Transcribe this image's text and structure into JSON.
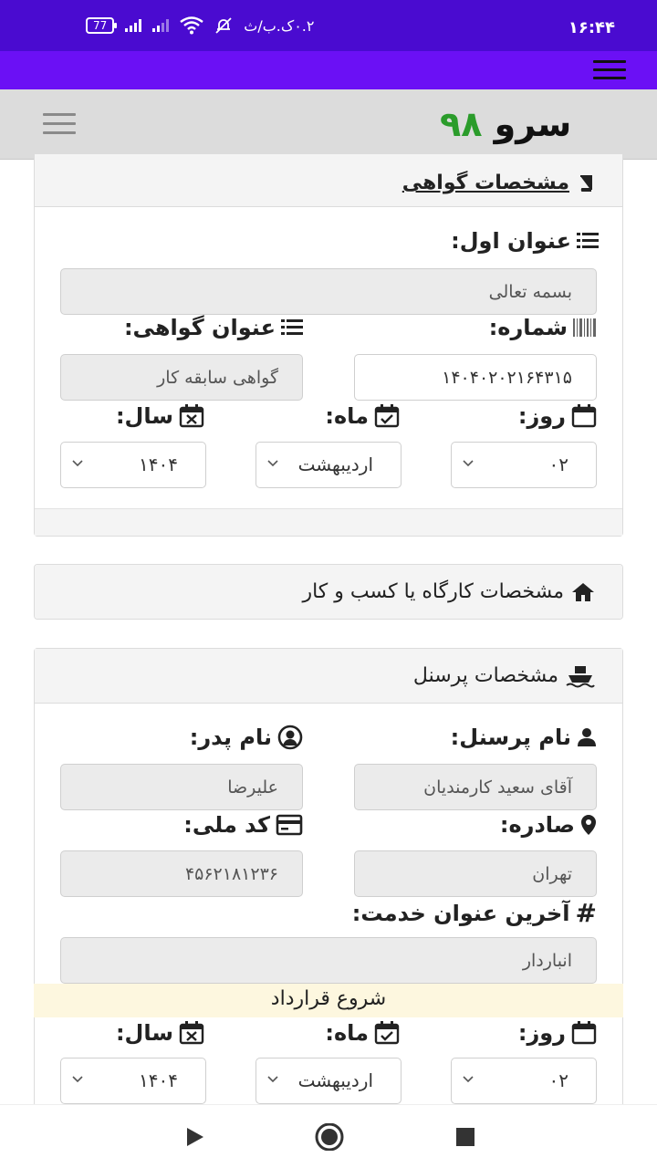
{
  "status_bar": {
    "time": "۱۶:۴۴",
    "battery": "77",
    "speed": "۰.۲ک.ب/ث"
  },
  "brand": {
    "part1": "سرو",
    "part2": "۹۸"
  },
  "certificate_section": {
    "header": "مشخصات گواهی",
    "first_title_label": "عنوان اول:",
    "first_title_value": "بسمه تعالی",
    "number_label": "شماره:",
    "number_value": "۱۴۰۴۰۲۰۲۱۶۴۳۱۵",
    "certificate_title_label": "عنوان گواهی:",
    "certificate_title_value": "گواهی سابقه کار",
    "day_label": "روز:",
    "month_label": "ماه:",
    "year_label": "سال:",
    "day_value": "۰۲",
    "month_value": "اردیبهشت",
    "year_value": "۱۴۰۴"
  },
  "workplace_section": {
    "header": "مشخصات کارگاه یا کسب و کار"
  },
  "personnel_section": {
    "header": "مشخصات پرسنل",
    "name_label": "نام پرسنل:",
    "name_value": "آقای سعید کارمندیان",
    "father_label": "نام پدر:",
    "father_value": "علیرضا",
    "issued_label": "صادره:",
    "issued_value": "تهران",
    "national_code_label": "کد ملی:",
    "national_code_value": "۴۵۶۲۱۸۱۲۳۶",
    "last_title_label": "آخرین عنوان خدمت:",
    "last_title_value": "انباردار"
  },
  "contract_start": {
    "banner": "شروع قرارداد",
    "day_label": "روز:",
    "month_label": "ماه:",
    "year_label": "سال:",
    "day_value": "۰۲",
    "month_value": "اردیبهشت",
    "year_value": "۱۴۰۴"
  }
}
